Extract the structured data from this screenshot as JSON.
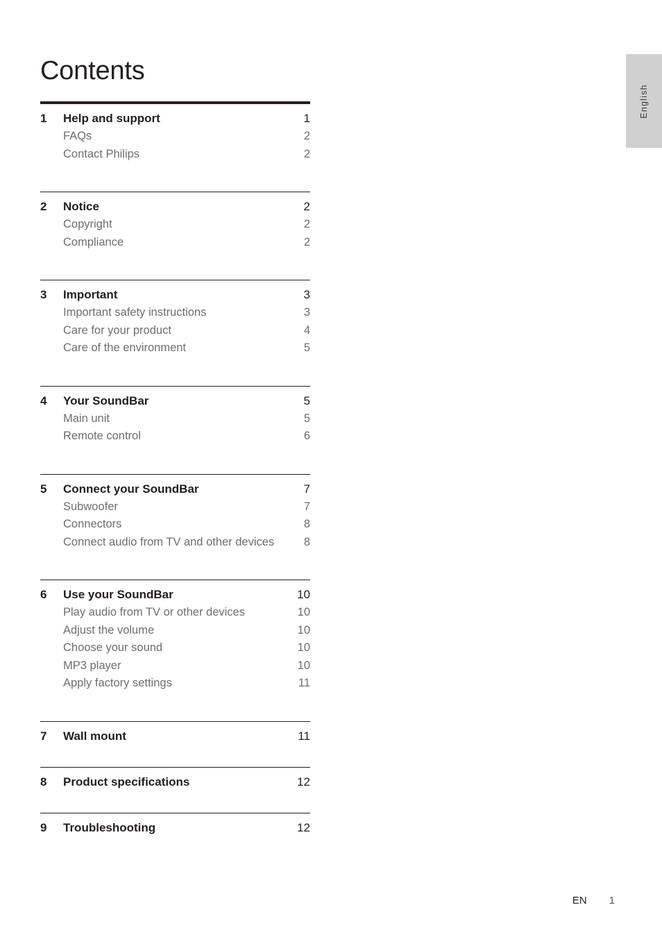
{
  "page_title": "Contents",
  "language_tab": {
    "label": "English",
    "background_color": "#d0d0d0"
  },
  "footer": {
    "language_code": "EN",
    "page_number": "1"
  },
  "colors": {
    "heading_text": "#231f20",
    "sub_text": "#6e6e6e",
    "rule": "#231f20"
  },
  "toc": {
    "sections": [
      {
        "number": "1",
        "title": "Help and support",
        "page": "1",
        "rule": "thick",
        "extra_gap_after_heading": true,
        "items": [
          {
            "label": "FAQs",
            "page": "2"
          },
          {
            "label": "Contact Philips",
            "page": "2"
          }
        ]
      },
      {
        "number": "2",
        "title": "Notice",
        "page": "2",
        "rule": "thin",
        "extra_gap_after_heading": false,
        "items": [
          {
            "label": "Copyright",
            "page": "2"
          },
          {
            "label": "Compliance",
            "page": "2"
          }
        ]
      },
      {
        "number": "3",
        "title": "Important",
        "page": "3",
        "rule": "thin",
        "extra_gap_after_heading": false,
        "items": [
          {
            "label": "Important safety instructions",
            "page": "3"
          },
          {
            "label": "Care for your product",
            "page": "4"
          },
          {
            "label": "Care of the environment",
            "page": "5"
          }
        ]
      },
      {
        "number": "4",
        "title": "Your SoundBar",
        "page": "5",
        "rule": "thin",
        "extra_gap_after_heading": false,
        "items": [
          {
            "label": "Main unit",
            "page": "5"
          },
          {
            "label": "Remote control",
            "page": "6"
          }
        ]
      },
      {
        "number": "5",
        "title": "Connect your SoundBar",
        "page": "7",
        "rule": "thin",
        "extra_gap_after_heading": false,
        "items": [
          {
            "label": "Subwoofer",
            "page": "7"
          },
          {
            "label": "Connectors",
            "page": "8"
          },
          {
            "label": "Connect audio from TV and other devices",
            "page": "8"
          }
        ]
      },
      {
        "number": "6",
        "title": "Use your SoundBar",
        "page": "10",
        "rule": "thin",
        "extra_gap_after_heading": false,
        "items": [
          {
            "label": "Play audio from TV or other devices",
            "page": "10"
          },
          {
            "label": "Adjust the volume",
            "page": "10"
          },
          {
            "label": "Choose your sound",
            "page": "10"
          },
          {
            "label": "MP3 player",
            "page": "10"
          },
          {
            "label": "Apply factory settings",
            "page": "11"
          }
        ]
      },
      {
        "number": "7",
        "title": "Wall mount",
        "page": "11",
        "rule": "thin",
        "extra_gap_after_heading": false,
        "items": []
      },
      {
        "number": "8",
        "title": "Product specifications",
        "page": "12",
        "rule": "thin",
        "extra_gap_after_heading": false,
        "items": []
      },
      {
        "number": "9",
        "title": "Troubleshooting",
        "page": "12",
        "rule": "thin",
        "extra_gap_after_heading": false,
        "items": []
      }
    ]
  }
}
